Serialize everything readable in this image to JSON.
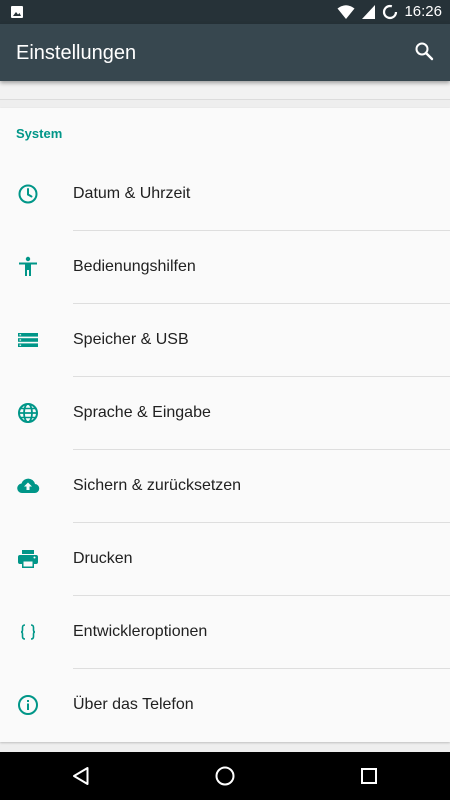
{
  "status_bar": {
    "time": "16:26"
  },
  "app_bar": {
    "title": "Einstellungen"
  },
  "section": {
    "title": "System"
  },
  "items": [
    {
      "label": "Datum & Uhrzeit",
      "icon": "clock-icon"
    },
    {
      "label": "Bedienungshilfen",
      "icon": "accessibility-icon"
    },
    {
      "label": "Speicher & USB",
      "icon": "storage-icon"
    },
    {
      "label": "Sprache & Eingabe",
      "icon": "globe-icon"
    },
    {
      "label": "Sichern & zurücksetzen",
      "icon": "cloud-upload-icon"
    },
    {
      "label": "Drucken",
      "icon": "printer-icon"
    },
    {
      "label": "Entwickleroptionen",
      "icon": "code-braces-icon"
    },
    {
      "label": "Über das Telefon",
      "icon": "info-icon"
    }
  ],
  "colors": {
    "accent": "#009688",
    "app_bar": "#37474f",
    "status_bar": "#263238"
  }
}
